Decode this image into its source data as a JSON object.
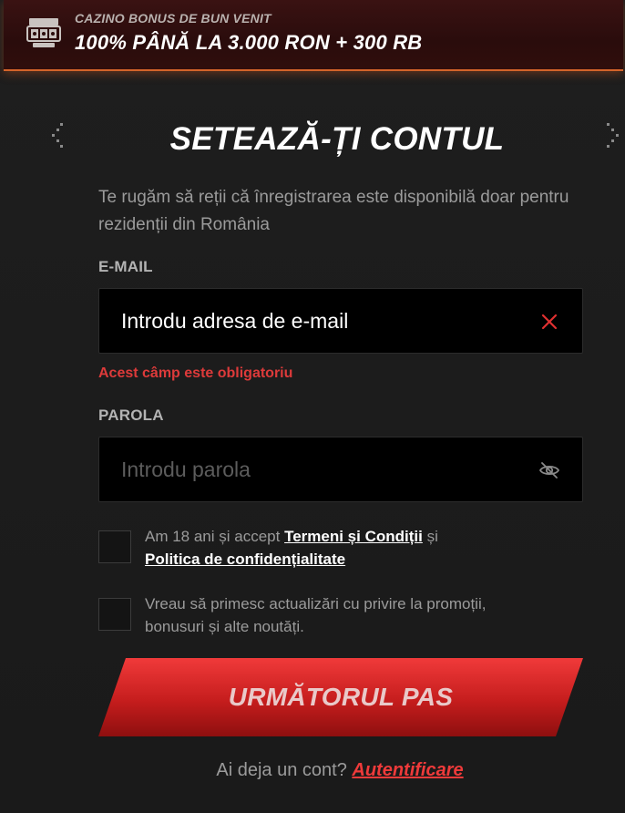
{
  "banner": {
    "subtitle": "CAZINO BONUS DE BUN VENIT",
    "title": "100% PÂNĂ LA 3.000 RON + 300 RB",
    "icon": "slot-machine-icon"
  },
  "nav": {
    "prev_icon": "chevron-left-icon",
    "next_icon": "chevron-right-icon"
  },
  "form": {
    "title": "SETEAZĂ-ȚI CONTUL",
    "notice": "Te rugăm să reții că înregistrarea este disponibilă doar pentru rezidenții din România",
    "email": {
      "label": "E-MAIL",
      "value": "",
      "placeholder": "Introdu adresa de e-mail",
      "error": "Acest câmp este obligatoriu"
    },
    "password": {
      "label": "PAROLA",
      "value": "",
      "placeholder": "Introdu parola"
    },
    "terms": {
      "checked": false,
      "text_before": "Am 18 ani și accept ",
      "terms_link": "Termeni și Condiții",
      "text_middle": " și",
      "privacy_link": "Politica de confidențialitate"
    },
    "marketing": {
      "checked": false,
      "text": "Vreau să primesc actualizări cu privire la promoții, bonusuri și alte noutăți."
    },
    "submit_label": "URMĂTORUL PAS",
    "login_prompt": "Ai deja un cont?",
    "login_link": "Autentificare"
  },
  "colors": {
    "accent_red": "#e03030",
    "error_red": "#dd3a3a",
    "banner_border": "#d4642a",
    "background": "#1b1b1b"
  }
}
